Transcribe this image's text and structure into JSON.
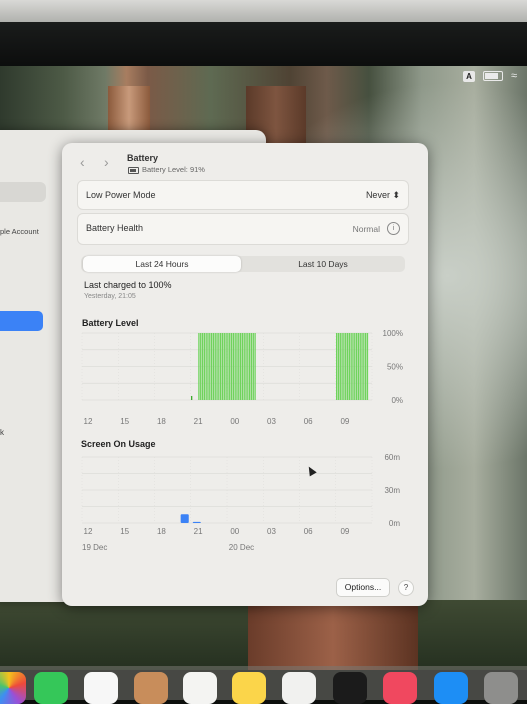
{
  "menubar": {
    "input_source": "A"
  },
  "sidebar": {
    "apple_account_label": "ple Account",
    "stub_label": "k"
  },
  "window": {
    "title": "Battery",
    "subtitle": "Battery Level: 91%",
    "low_power_mode": {
      "label": "Low Power Mode",
      "value": "Never ⬍"
    },
    "battery_health": {
      "label": "Battery Health",
      "value": "Normal"
    },
    "tabs": [
      {
        "label": "Last 24 Hours",
        "selected": true
      },
      {
        "label": "Last 10 Days",
        "selected": false
      }
    ],
    "last_charged": "Last charged to 100%",
    "last_charged_time": "Yesterday, 21:05",
    "options_label": "Options...",
    "help_label": "?"
  },
  "colors": {
    "battery_bar": "#6fd35c",
    "battery_low_bar": "#3faa2f",
    "usage_bar": "#3b82f6",
    "grid": "#dcdcd8"
  },
  "chart_data": [
    {
      "type": "bar",
      "title": "Battery Level",
      "x_ticks": [
        "12",
        "15",
        "18",
        "21",
        "00",
        "03",
        "06",
        "09"
      ],
      "y_ticks": [
        "100%",
        "50%",
        "0%"
      ],
      "ylim": [
        0,
        100
      ],
      "bars_per_hour": 4,
      "values": [
        0,
        0,
        0,
        0,
        0,
        0,
        0,
        0,
        0,
        0,
        0,
        0,
        0,
        0,
        0,
        0,
        0,
        0,
        0,
        0,
        0,
        0,
        0,
        0,
        0,
        0,
        0,
        0,
        0,
        0,
        0,
        0,
        0,
        0,
        0,
        0,
        0,
        0,
        0,
        0,
        0,
        0,
        0,
        0,
        0,
        0,
        0,
        0,
        0,
        0,
        0,
        0,
        0,
        0,
        0,
        0,
        0,
        0,
        0,
        0,
        6,
        0,
        0,
        0,
        100,
        100,
        100,
        100,
        100,
        100,
        100,
        100,
        100,
        100,
        100,
        100,
        100,
        100,
        100,
        100,
        100,
        100,
        100,
        100,
        100,
        100,
        100,
        100,
        100,
        100,
        100,
        100,
        100,
        100,
        100,
        100,
        0,
        0,
        0,
        0,
        0,
        0,
        0,
        0,
        0,
        0,
        0,
        0,
        0,
        0,
        0,
        0,
        0,
        0,
        0,
        0,
        0,
        0,
        0,
        0,
        0,
        0,
        0,
        0,
        0,
        0,
        0,
        0,
        0,
        0,
        0,
        0,
        0,
        0,
        0,
        0,
        0,
        0,
        0,
        0,
        100,
        100,
        100,
        100,
        100,
        100,
        100,
        100,
        100,
        100,
        100,
        100,
        100,
        100,
        100,
        100,
        100,
        100,
        0,
        0
      ]
    },
    {
      "type": "bar",
      "title": "Screen On Usage",
      "x_ticks": [
        "12",
        "15",
        "18",
        "21",
        "00",
        "03",
        "06",
        "09"
      ],
      "x_sub_labels": [
        {
          "tick": "12",
          "label": "19 Dec"
        },
        {
          "tick": "00",
          "label": "20 Dec"
        }
      ],
      "y_ticks": [
        "60m",
        "30m",
        "0m"
      ],
      "ylim": [
        0,
        60
      ],
      "hourly_minutes": [
        0,
        0,
        0,
        0,
        0,
        0,
        0,
        0,
        8,
        1,
        0,
        0,
        0,
        0,
        0,
        0,
        0,
        0,
        0,
        0,
        0,
        0,
        0,
        0
      ]
    }
  ]
}
